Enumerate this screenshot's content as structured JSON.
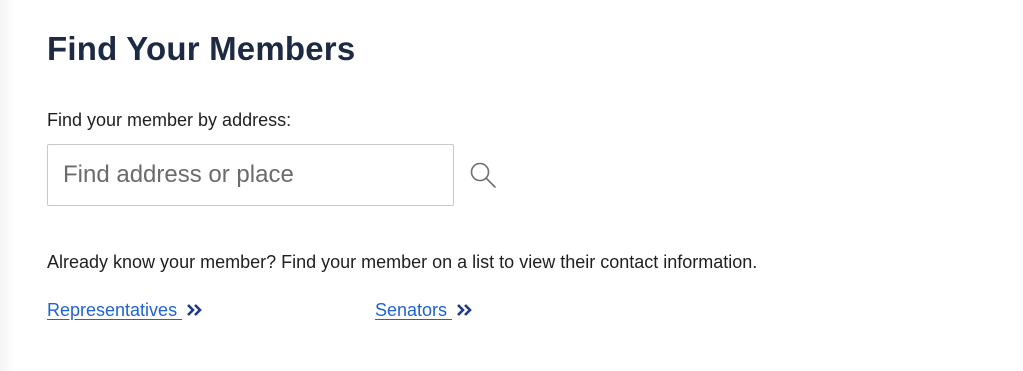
{
  "heading": {
    "title": "Find Your Members"
  },
  "address_search": {
    "label": "Find your member by address:",
    "placeholder": "Find address or place",
    "value": "",
    "search_icon": "search-icon"
  },
  "list_lookup": {
    "prompt": "Already know your member? Find your member on a list to view their contact information.",
    "links": [
      {
        "label": "Representatives ",
        "icon": "double-chevron-right-icon"
      },
      {
        "label": "Senators ",
        "icon": "double-chevron-right-icon"
      }
    ]
  },
  "colors": {
    "heading": "#1d2a44",
    "link": "#1e62d6",
    "chevron": "#1e3a8a",
    "input_border": "#c8c8c8"
  }
}
